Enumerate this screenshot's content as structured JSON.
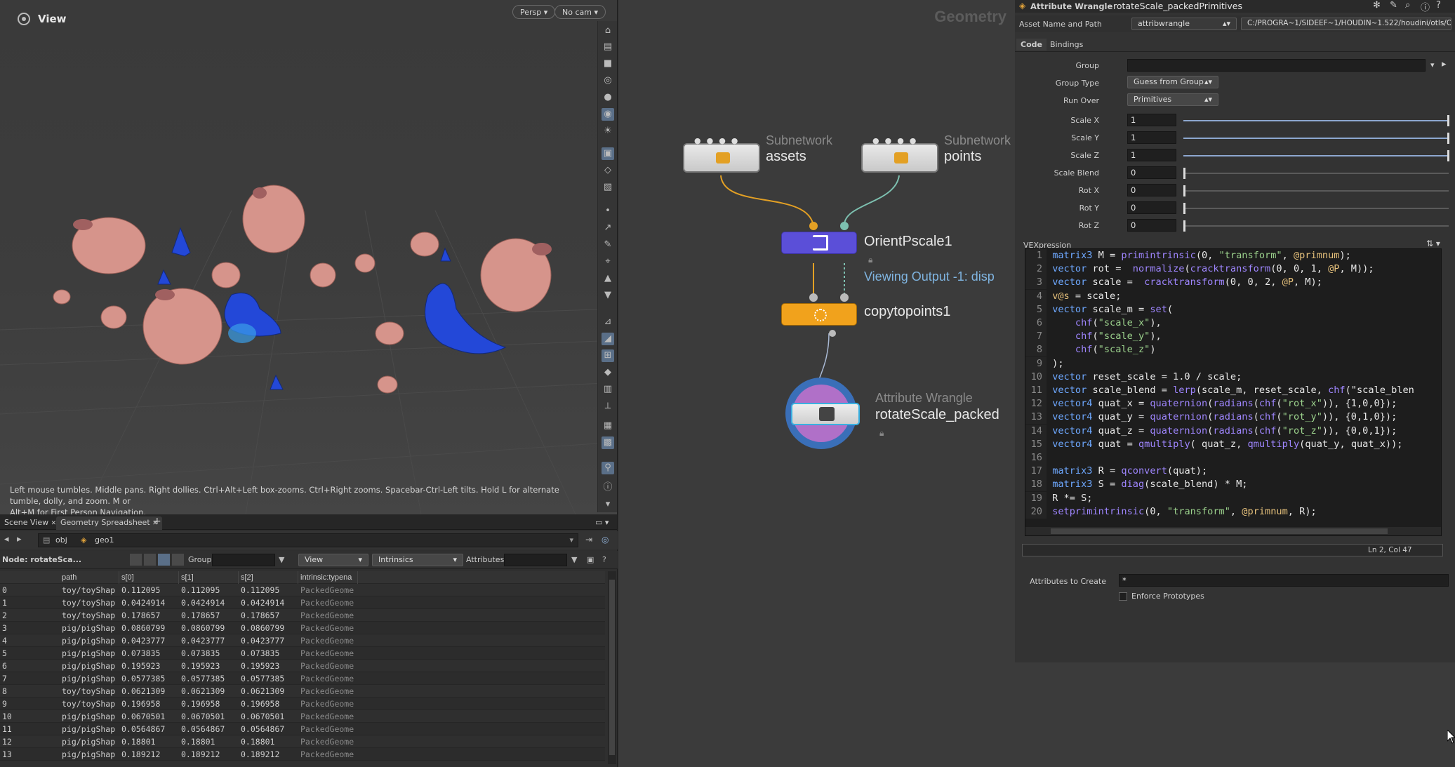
{
  "viewport": {
    "title": "View",
    "persp_label": "Persp",
    "cam_label": "No cam",
    "help_line1": "Left mouse tumbles. Middle pans. Right dollies. Ctrl+Alt+Left box-zooms. Ctrl+Right zooms. Spacebar-Ctrl-Left tilts. Hold L for alternate tumble, dolly, and zoom. M or",
    "help_line2": "Alt+M for First Person Navigation."
  },
  "bottom_tabs": {
    "scene_view": "Scene View",
    "geometry_spreadsheet": "Geometry Spreadsheet",
    "add": "+"
  },
  "pathbar": {
    "obj": "obj",
    "geo": "geo1"
  },
  "sheet_controls": {
    "node_label": "Node: rotateSca...",
    "group_label": "Group:",
    "view_dropdown": "View",
    "intrinsics_dropdown": "Intrinsics",
    "attributes_label": "Attributes:"
  },
  "table": {
    "headers": [
      "",
      "path",
      "s[0]",
      "s[1]",
      "s[2]",
      "intrinsic:typena"
    ],
    "rows": [
      [
        "0",
        "toy/toyShap",
        "0.112095",
        "0.112095",
        "0.112095",
        "PackedGeome"
      ],
      [
        "1",
        "toy/toyShap",
        "0.0424914",
        "0.0424914",
        "0.0424914",
        "PackedGeome"
      ],
      [
        "2",
        "toy/toyShap",
        "0.178657",
        "0.178657",
        "0.178657",
        "PackedGeome"
      ],
      [
        "3",
        "pig/pigShap",
        "0.0860799",
        "0.0860799",
        "0.0860799",
        "PackedGeome"
      ],
      [
        "4",
        "pig/pigShap",
        "0.0423777",
        "0.0423777",
        "0.0423777",
        "PackedGeome"
      ],
      [
        "5",
        "pig/pigShap",
        "0.073835",
        "0.073835",
        "0.073835",
        "PackedGeome"
      ],
      [
        "6",
        "pig/pigShap",
        "0.195923",
        "0.195923",
        "0.195923",
        "PackedGeome"
      ],
      [
        "7",
        "pig/pigShap",
        "0.0577385",
        "0.0577385",
        "0.0577385",
        "PackedGeome"
      ],
      [
        "8",
        "toy/toyShap",
        "0.0621309",
        "0.0621309",
        "0.0621309",
        "PackedGeome"
      ],
      [
        "9",
        "toy/toyShap",
        "0.196958",
        "0.196958",
        "0.196958",
        "PackedGeome"
      ],
      [
        "10",
        "pig/pigShap",
        "0.0670501",
        "0.0670501",
        "0.0670501",
        "PackedGeome"
      ],
      [
        "11",
        "pig/pigShap",
        "0.0564867",
        "0.0564867",
        "0.0564867",
        "PackedGeome"
      ],
      [
        "12",
        "pig/pigShap",
        "0.18801",
        "0.18801",
        "0.18801",
        "PackedGeome"
      ],
      [
        "13",
        "pig/pigShap",
        "0.189212",
        "0.189212",
        "0.189212",
        "PackedGeome"
      ]
    ]
  },
  "network": {
    "title": "Geometry",
    "nodes": {
      "assets": {
        "type": "Subnetwork",
        "name": "assets"
      },
      "points": {
        "type": "Subnetwork",
        "name": "points"
      },
      "orient": {
        "name": "OrientPscale1",
        "status": "Viewing Output -1: disp"
      },
      "copy": {
        "name": "copytopoints1"
      },
      "wrangle": {
        "type": "Attribute Wrangle",
        "name": "rotateScale_packed"
      }
    }
  },
  "params": {
    "header_type": "Attribute Wrangle",
    "header_name": "rotateScale_packedPrimitives",
    "asset_label": "Asset Name and Path",
    "asset_name": "attribwrangle",
    "asset_path": "C:/PROGRA~1/SIDEEF~1/HOUDIN~1.522/houdini/otls/OPI...",
    "tab_code": "Code",
    "tab_bindings": "Bindings",
    "group_label": "Group",
    "group_value": "",
    "group_type_label": "Group Type",
    "group_type_value": "Guess from Group",
    "run_over_label": "Run Over",
    "run_over_value": "Primitives",
    "fields": [
      {
        "label": "Scale X",
        "value": "1",
        "level": 1.0
      },
      {
        "label": "Scale Y",
        "value": "1",
        "level": 1.0
      },
      {
        "label": "Scale Z",
        "value": "1",
        "level": 1.0
      },
      {
        "label": "Scale Blend",
        "value": "0",
        "level": 0.0
      },
      {
        "label": "Rot X",
        "value": "0",
        "level": 0.0
      },
      {
        "label": "Rot Y",
        "value": "0",
        "level": 0.0
      },
      {
        "label": "Rot Z",
        "value": "0",
        "level": 0.0
      }
    ],
    "vex_label": "VEXpression",
    "cursor_status": "Ln 2, Col 47",
    "attrs_create_label": "Attributes to Create",
    "attrs_create_value": "*",
    "enforce_label": "Enforce Prototypes"
  },
  "code_lines": [
    "matrix3 M = primintrinsic(0, \"transform\", @primnum);",
    "vector rot =  normalize(cracktransform(0, 0, 1, @P, M));",
    "vector scale =  cracktransform(0, 0, 2, @P, M);",
    "v@s = scale;",
    "vector scale_m = set(",
    "    chf(\"scale_x\"),",
    "    chf(\"scale_y\"),",
    "    chf(\"scale_z\")",
    ");",
    "vector reset_scale = 1.0 / scale;",
    "vector scale_blend = lerp(scale_m, reset_scale, chf(\"scale_blen",
    "vector4 quat_x = quaternion(radians(chf(\"rot_x\")), {1,0,0});",
    "vector4 quat_y = quaternion(radians(chf(\"rot_y\")), {0,1,0});",
    "vector4 quat_z = quaternion(radians(chf(\"rot_z\")), {0,0,1});",
    "vector4 quat = qmultiply( quat_z, qmultiply(quat_y, quat_x));",
    "",
    "matrix3 R = qconvert(quat);",
    "matrix3 S = diag(scale_blend) * M;",
    "R *= S;",
    "setprimintrinsic(0, \"transform\", @primnum, R);"
  ],
  "colors": {
    "accent_blue": "#5a6f88",
    "orient_node": "#5b4fd8",
    "copy_node": "#f1a21c",
    "pig": "#d7938a",
    "toy": "#1f4fd6"
  }
}
